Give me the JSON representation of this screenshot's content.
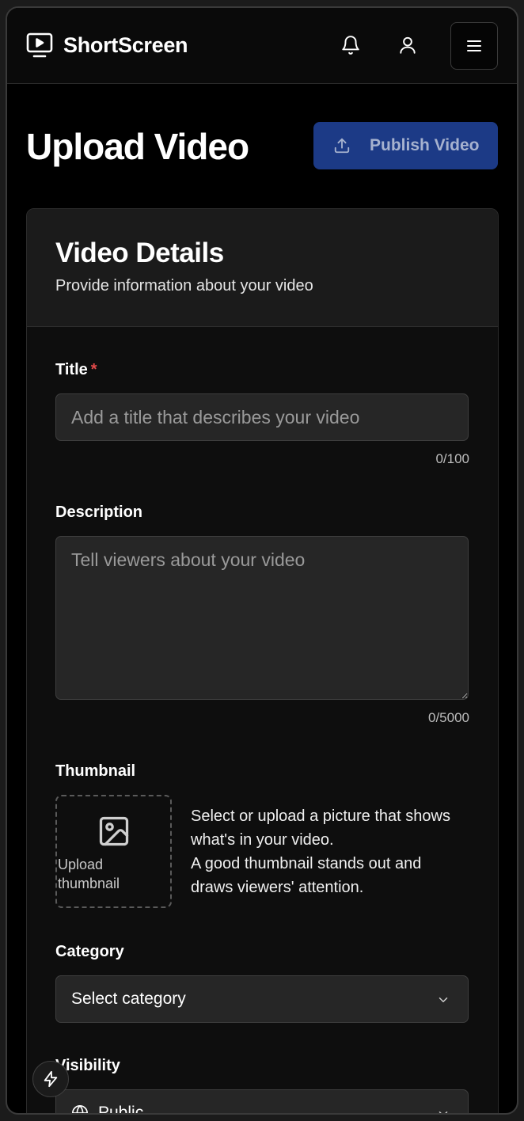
{
  "app": {
    "brand": "ShortScreen"
  },
  "header": {
    "icons": [
      "play-logo-icon",
      "bell-icon",
      "user-icon",
      "hamburger-menu-icon"
    ]
  },
  "page": {
    "title": "Upload Video",
    "publish_label": "Publish Video"
  },
  "card": {
    "title": "Video Details",
    "subtitle": "Provide information about your video"
  },
  "form": {
    "title": {
      "label": "Title",
      "required_mark": "*",
      "placeholder": "Add a title that describes your video",
      "value": "",
      "counter": "0/100"
    },
    "description": {
      "label": "Description",
      "placeholder": "Tell viewers about your video",
      "value": "",
      "counter": "0/5000"
    },
    "thumbnail": {
      "label": "Thumbnail",
      "upload_label": "Upload thumbnail",
      "help_line1": "Select or upload a picture that shows what's in your video.",
      "help_line2": "A good thumbnail stands out and draws viewers' attention."
    },
    "category": {
      "label": "Category",
      "value": "Select category"
    },
    "visibility": {
      "label": "Visibility",
      "value": "Public"
    }
  },
  "colors": {
    "background": "#000000",
    "card": "#0e0e0e",
    "input": "#262626",
    "accent_button": "#1c3a86",
    "required": "#e24a4a"
  }
}
